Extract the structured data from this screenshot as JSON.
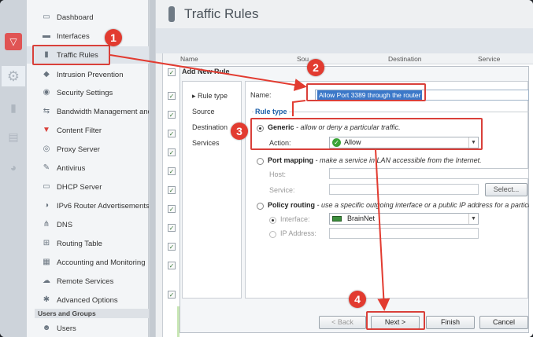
{
  "window": {
    "title": "Traffic Rules"
  },
  "sidebar": {
    "items": [
      {
        "label": "Dashboard",
        "icon": "dashboard-icon"
      },
      {
        "label": "Interfaces",
        "icon": "interfaces-icon"
      },
      {
        "label": "Traffic Rules",
        "icon": "traffic-light-icon"
      },
      {
        "label": "Intrusion Prevention",
        "icon": "shield-icon"
      },
      {
        "label": "Security Settings",
        "icon": "lock-icon"
      },
      {
        "label": "Bandwidth Management and",
        "icon": "bandwidth-icon"
      },
      {
        "label": "Content Filter",
        "icon": "funnel-icon"
      },
      {
        "label": "Proxy Server",
        "icon": "proxy-icon"
      },
      {
        "label": "Antivirus",
        "icon": "antivirus-icon"
      },
      {
        "label": "DHCP Server",
        "icon": "dhcp-icon"
      },
      {
        "label": "IPv6 Router Advertisements",
        "icon": "ipv6-icon"
      },
      {
        "label": "DNS",
        "icon": "dns-icon"
      },
      {
        "label": "Routing Table",
        "icon": "routing-icon"
      },
      {
        "label": "Accounting and Monitoring",
        "icon": "monitoring-icon"
      },
      {
        "label": "Remote Services",
        "icon": "cloud-icon"
      },
      {
        "label": "Advanced Options",
        "icon": "advanced-icon"
      }
    ],
    "section_users": "Users and Groups",
    "users_item": "Users"
  },
  "grid": {
    "columns": [
      "Name",
      "Sou",
      "Destination",
      "Service"
    ]
  },
  "dialog": {
    "title": "Add New Rule",
    "steps": [
      "Rule type",
      "Source",
      "Destination",
      "Services"
    ],
    "name_label": "Name:",
    "name_value": "Allow Port 3389 through the router",
    "rule_type_legend": "Rule type",
    "generic_title": "Generic",
    "generic_desc": " - allow or deny a particular traffic.",
    "action_label": "Action:",
    "action_value": "Allow",
    "port_title": "Port mapping",
    "port_desc": " - make a service in LAN accessible from the Internet.",
    "host_label": "Host:",
    "service_label": "Service:",
    "select_button": "Select...",
    "policy_title": "Policy routing",
    "policy_desc": " - use a specific outgoing interface or a public IP address for a particular",
    "interface_label": "Interface:",
    "interface_value": "BrainNet",
    "ip_label": "IP Address:",
    "back_button": "< Back",
    "next_button": "Next >",
    "finish_button": "Finish",
    "cancel_button": "Cancel"
  },
  "annotations": {
    "badge1": "1",
    "badge2": "2",
    "badge3": "3",
    "badge4": "4",
    "color": "#e23b30"
  }
}
